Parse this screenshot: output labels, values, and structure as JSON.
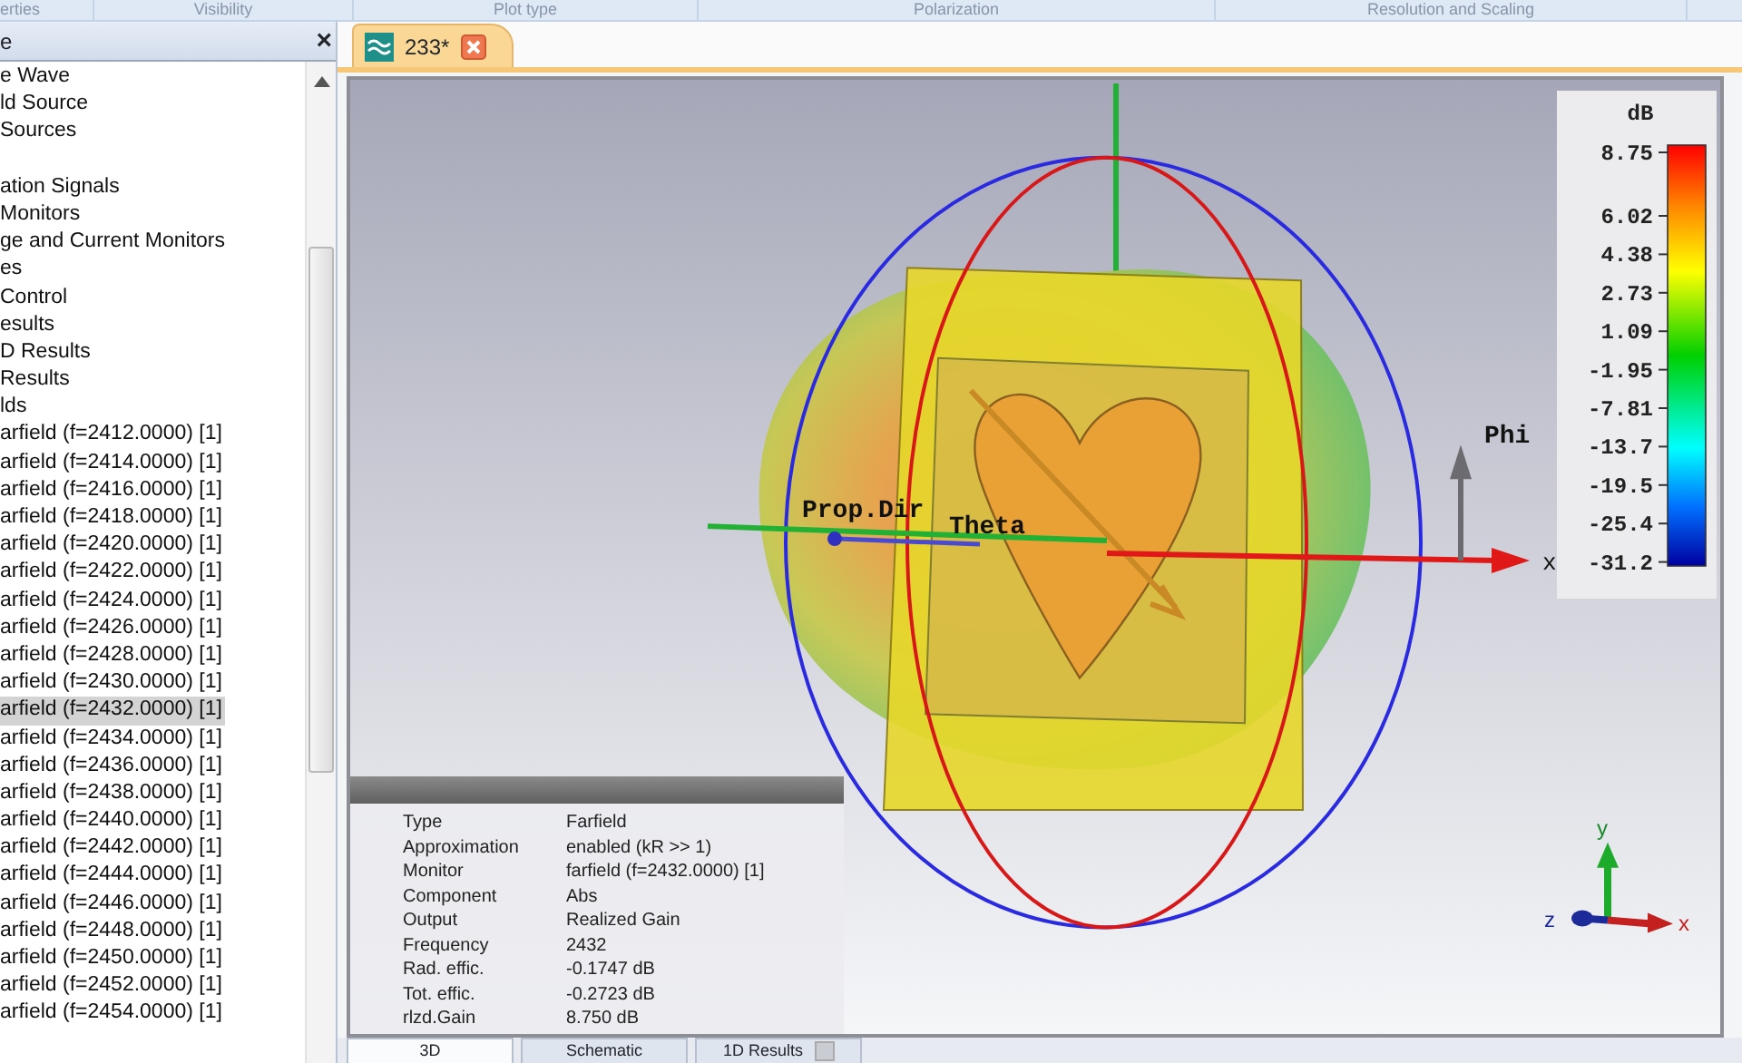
{
  "ribbon_groups": [
    "erties",
    "Visibility",
    "Plot type",
    "Polarization",
    "Resolution and Scaling"
  ],
  "tree_panel": {
    "title": "e",
    "close": "×",
    "items": [
      {
        "label": "e Wave",
        "selected": false
      },
      {
        "label": "ld Source",
        "selected": false
      },
      {
        "label": "Sources",
        "selected": false
      },
      {
        "label": "ation Signals",
        "selected": false
      },
      {
        "label": "Monitors",
        "selected": false
      },
      {
        "label": "ge and Current Monitors",
        "selected": false
      },
      {
        "label": "es",
        "selected": false
      },
      {
        "label": " Control",
        "selected": false
      },
      {
        "label": "esults",
        "selected": false
      },
      {
        "label": "D Results",
        "selected": false
      },
      {
        "label": "Results",
        "selected": false
      },
      {
        "label": "lds",
        "selected": false
      },
      {
        "label": "arfield (f=2412.0000) [1]",
        "selected": false
      },
      {
        "label": "arfield (f=2414.0000) [1]",
        "selected": false
      },
      {
        "label": "arfield (f=2416.0000) [1]",
        "selected": false
      },
      {
        "label": "arfield (f=2418.0000) [1]",
        "selected": false
      },
      {
        "label": "arfield (f=2420.0000) [1]",
        "selected": false
      },
      {
        "label": "arfield (f=2422.0000) [1]",
        "selected": false
      },
      {
        "label": "arfield (f=2424.0000) [1]",
        "selected": false
      },
      {
        "label": "arfield (f=2426.0000) [1]",
        "selected": false
      },
      {
        "label": "arfield (f=2428.0000) [1]",
        "selected": false
      },
      {
        "label": "arfield (f=2430.0000) [1]",
        "selected": false
      },
      {
        "label": "arfield (f=2432.0000) [1]",
        "selected": true
      },
      {
        "label": "arfield (f=2434.0000) [1]",
        "selected": false
      },
      {
        "label": "arfield (f=2436.0000) [1]",
        "selected": false
      },
      {
        "label": "arfield (f=2438.0000) [1]",
        "selected": false
      },
      {
        "label": "arfield (f=2440.0000) [1]",
        "selected": false
      },
      {
        "label": "arfield (f=2442.0000) [1]",
        "selected": false
      },
      {
        "label": "arfield (f=2444.0000) [1]",
        "selected": false
      },
      {
        "label": "arfield (f=2446.0000) [1]",
        "selected": false
      },
      {
        "label": "arfield (f=2448.0000) [1]",
        "selected": false
      },
      {
        "label": "arfield (f=2450.0000) [1]",
        "selected": false
      },
      {
        "label": "arfield (f=2452.0000) [1]",
        "selected": false
      },
      {
        "label": "arfield (f=2454.0000) [1]",
        "selected": false
      }
    ]
  },
  "document_tabs": [
    {
      "label": "233*",
      "selected": true
    }
  ],
  "viewport": {
    "labels": {
      "prop_dir": "Prop.Dir",
      "theta": "Theta",
      "phi": "Phi",
      "x_axis": "x"
    },
    "triad": {
      "x": "x",
      "y": "y",
      "z": "z"
    },
    "legend": {
      "unit": "dB",
      "ticks": [
        "8.75",
        "6.02",
        "4.38",
        "2.73",
        "1.09",
        "-1.95",
        "-7.81",
        "-13.7",
        "-19.5",
        "-25.4",
        "-31.2"
      ]
    },
    "info": [
      {
        "name": "Type",
        "value": "Farfield"
      },
      {
        "name": "Approximation",
        "value": "enabled (kR >> 1)"
      },
      {
        "name": "Monitor",
        "value": "farfield (f=2432.0000) [1]"
      },
      {
        "name": "Component",
        "value": "Abs"
      },
      {
        "name": "Output",
        "value": "Realized Gain"
      },
      {
        "name": "Frequency",
        "value": "2432"
      },
      {
        "name": "Rad. effic.",
        "value": "-0.1747 dB"
      },
      {
        "name": "Tot. effic.",
        "value": "-0.2723 dB"
      },
      {
        "name": "rlzd.Gain",
        "value": "8.750 dB"
      }
    ]
  },
  "view_tabs": [
    {
      "label": "3D",
      "selected": true,
      "closable": false
    },
    {
      "label": "Schematic",
      "selected": false,
      "closable": false
    },
    {
      "label": "1D Results",
      "selected": false,
      "closable": true
    }
  ]
}
